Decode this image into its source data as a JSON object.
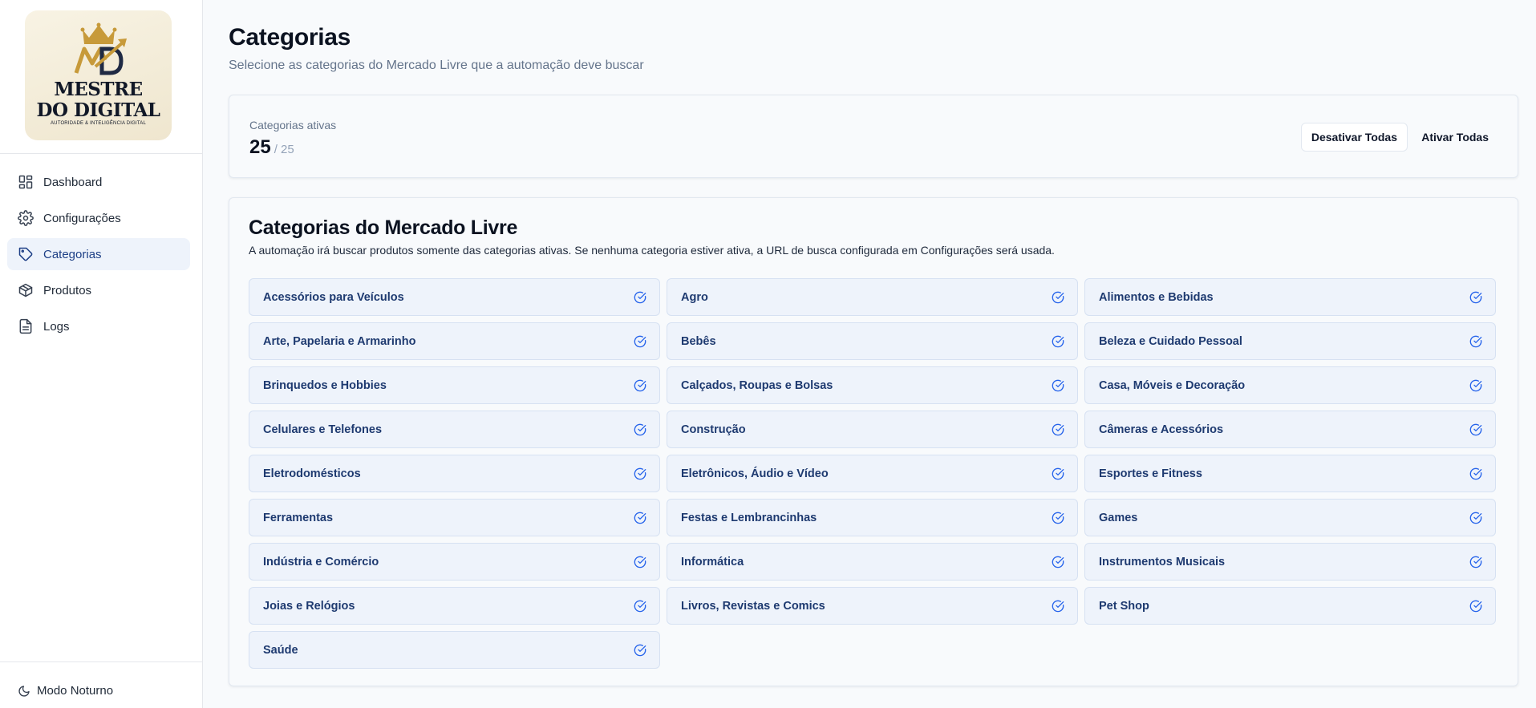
{
  "logo": {
    "title_line1": "MESTRE",
    "title_line2": "DO DIGITAL",
    "subtitle": "AUTORIDADE & INTELIGÊNCIA DIGITAL"
  },
  "sidebar": {
    "items": [
      {
        "label": "Dashboard",
        "icon": "dashboard-icon",
        "active": false
      },
      {
        "label": "Configurações",
        "icon": "gear-icon",
        "active": false
      },
      {
        "label": "Categorias",
        "icon": "tag-icon",
        "active": true
      },
      {
        "label": "Produtos",
        "icon": "package-icon",
        "active": false
      },
      {
        "label": "Logs",
        "icon": "file-icon",
        "active": false
      }
    ],
    "footer_label": "Modo Noturno"
  },
  "header": {
    "title": "Categorias",
    "subtitle": "Selecione as categorias do Mercado Livre que a automação deve buscar"
  },
  "stats": {
    "label": "Categorias ativas",
    "active": "25",
    "total": "/ 25",
    "deactivate_label": "Desativar Todas",
    "activate_label": "Ativar Todas"
  },
  "categories": {
    "title": "Categorias do Mercado Livre",
    "description": "A automação irá buscar produtos somente das categorias ativas. Se nenhuma categoria estiver ativa, a URL de busca configurada em Configurações será usada.",
    "items": [
      "Acessórios para Veículos",
      "Agro",
      "Alimentos e Bebidas",
      "Arte, Papelaria e Armarinho",
      "Bebês",
      "Beleza e Cuidado Pessoal",
      "Brinquedos e Hobbies",
      "Calçados, Roupas e Bolsas",
      "Casa, Móveis e Decoração",
      "Celulares e Telefones",
      "Construção",
      "Câmeras e Acessórios",
      "Eletrodomésticos",
      "Eletrônicos, Áudio e Vídeo",
      "Esportes e Fitness",
      "Ferramentas",
      "Festas e Lembrancinhas",
      "Games",
      "Indústria e Comércio",
      "Informática",
      "Instrumentos Musicais",
      "Joias e Relógios",
      "Livros, Revistas e Comics",
      "Pet Shop",
      "Saúde"
    ]
  },
  "colors": {
    "accent": "#1d3f86",
    "check": "#2563eb",
    "card_bg": "#eef3fb"
  }
}
